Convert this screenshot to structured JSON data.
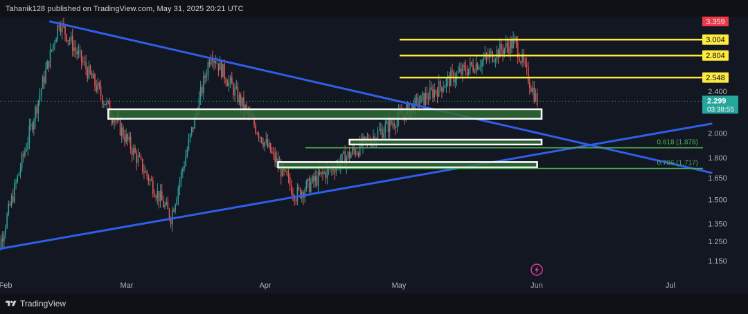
{
  "header": {
    "published_by": "Tahanik128 published on TradingView.com, May 31, 2025 20:21 UTC"
  },
  "footer": {
    "brand": "TradingView"
  },
  "colors": {
    "background": "#131722",
    "up": "#26a69a",
    "down": "#ef5350",
    "trendline": "#2f5ee8",
    "target": "#ffeb3b",
    "fib": "#4caf50",
    "zone_fill": "#2e6b35",
    "zone_border": "#ffffff",
    "price_label_bg": "#26a69a",
    "high_label_bg": "#f23645"
  },
  "chart_data": {
    "type": "candlestick",
    "title": "",
    "x_ticks": [
      "Feb",
      "Mar",
      "Apr",
      "May",
      "Jun",
      "Jul"
    ],
    "y_ticks": [
      "1.150",
      "1.250",
      "1.350",
      "1.500",
      "1.650",
      "1.800",
      "2.000",
      "2.400"
    ],
    "y_scale": "log",
    "ylim": [
      1.1,
      3.35
    ],
    "last_price": "2.299",
    "countdown": "03:38:55",
    "high_label": "3.359",
    "target_levels": [
      {
        "label": "3.004",
        "value": 3.004
      },
      {
        "label": "2.804",
        "value": 2.804
      },
      {
        "label": "2.548",
        "value": 2.548
      }
    ],
    "fib_levels": [
      {
        "label": "0.618 (1.878)",
        "value": 1.878
      },
      {
        "label": "0.786 (1.717)",
        "value": 1.717
      }
    ],
    "support_zones": [
      {
        "low": 2.13,
        "high": 2.22,
        "from": "Feb 24",
        "to": "Jun 01"
      },
      {
        "low": 1.905,
        "high": 1.945,
        "from": "Apr 19",
        "to": "Jun 01"
      },
      {
        "low": 1.725,
        "high": 1.765,
        "from": "Apr 03",
        "to": "May 31"
      }
    ],
    "trendlines": [
      {
        "name": "",
        "from": {
          "date": "Feb 11",
          "price": 3.25
        },
        "to": {
          "date": "Jul 09",
          "price": 1.685
        }
      },
      {
        "name": "",
        "from": {
          "date": "Jan 28",
          "price": 1.2
        },
        "to": {
          "date": "Jul 09",
          "price": 2.085
        }
      }
    ],
    "key_points": [
      {
        "date": "Jan 29",
        "price": 1.09
      },
      {
        "date": "Feb 13",
        "price": 3.25
      },
      {
        "date": "Mar 10",
        "price": 1.39
      },
      {
        "date": "Mar 19",
        "price": 2.85
      },
      {
        "date": "Apr 07",
        "price": 1.53
      },
      {
        "date": "May 12",
        "price": 2.55
      },
      {
        "date": "May 26",
        "price": 2.97
      },
      {
        "date": "May 31",
        "price": 2.299
      }
    ]
  }
}
